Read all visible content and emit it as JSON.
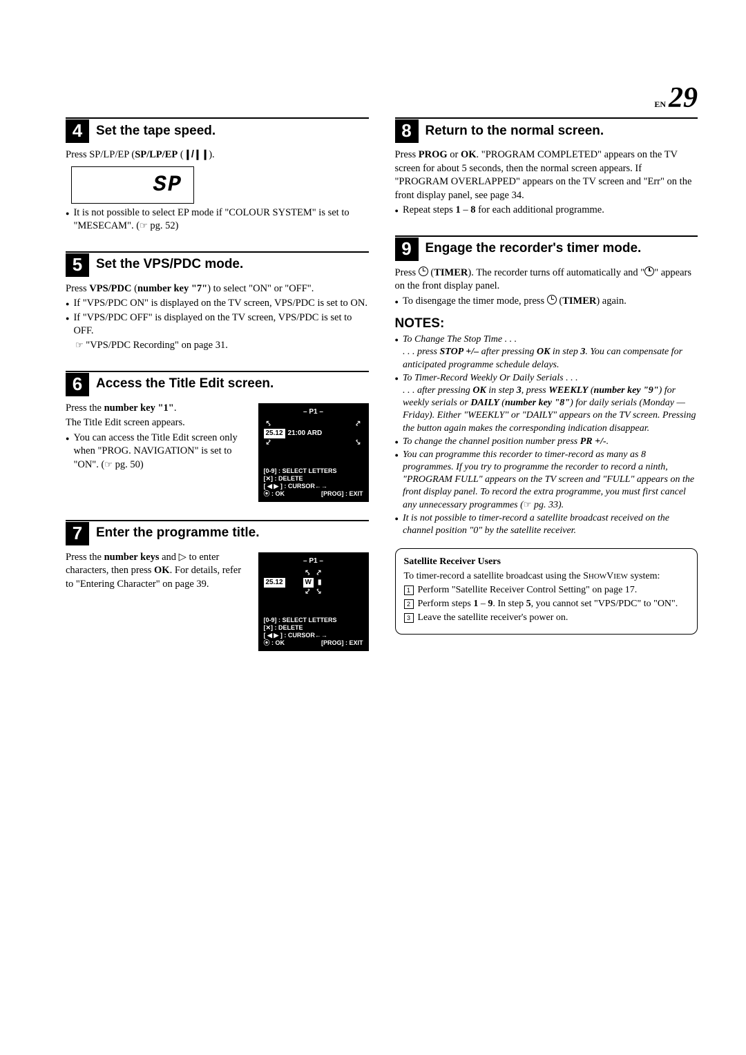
{
  "page": {
    "en": "EN",
    "num": "29"
  },
  "step4": {
    "num": "4",
    "title": "Set the tape speed.",
    "line": "Press SP/LP/EP (",
    "tapeglyph": "❙/❙❙",
    "line_end": ").",
    "sp": "SP",
    "bullet": "It is not possible to select EP mode if \"COLOUR SYSTEM\" is set to \"MESECAM\". (",
    "bullet_ref": "☞ pg. 52",
    "bullet_close": ")"
  },
  "step5": {
    "num": "5",
    "title": "Set the VPS/PDC mode.",
    "line": "Press VPS/PDC (number key \"7\") to select \"ON\" or \"OFF\".",
    "b1": "If \"VPS/PDC ON\" is displayed on the TV screen, VPS/PDC is set to ON.",
    "b2": "If \"VPS/PDC OFF\" is displayed on the TV screen, VPS/PDC is set to OFF.",
    "ref": "☞ \"VPS/PDC Recording\" on page 31."
  },
  "step6": {
    "num": "6",
    "title": "Access the Title Edit screen.",
    "l1": "Press the number key \"1\".",
    "l2": "The Title Edit screen appears.",
    "b": "You can access the Title Edit screen only when \"PROG. NAVIGATION\" is set to \"ON\". (",
    "b_ref": "☞ pg. 50",
    "b_close": ")",
    "screen": {
      "p1": "– P1 –",
      "date": "25.12",
      "time": "21:00 ARD",
      "leg1": "[0-9] : SELECT LETTERS",
      "leg2": "[✕] : DELETE",
      "leg3": "[ ◀ ▶ ] : CURSOR←→",
      "leg4a": "⦿ : OK",
      "leg4b": "[PROG] : EXIT"
    }
  },
  "step7": {
    "num": "7",
    "title": "Enter the programme title.",
    "l": "Press the number keys and ▷ to enter characters, then press OK. For details, refer to \"Entering Character\" on page 39.",
    "screen": {
      "p1": "– P1 –",
      "date": "25.12",
      "w": "W",
      "leg1": "[0-9] : SELECT LETTERS",
      "leg2": "[✕] : DELETE",
      "leg3": "[ ◀ ▶ ] : CURSOR←→",
      "leg4a": "⦿ : OK",
      "leg4b": "[PROG] : EXIT"
    }
  },
  "step8": {
    "num": "8",
    "title": "Return to the normal screen.",
    "p": "Press PROG or OK. \"PROGRAM COMPLETED\" appears on the TV screen for about 5 seconds, then the normal screen appears. If \"PROGRAM OVERLAPPED\" appears on the TV screen and \"Err\" on the front display panel, see page 34.",
    "b": "Repeat steps 1 – 8 for each additional programme."
  },
  "step9": {
    "num": "9",
    "title": "Engage the recorder's timer mode.",
    "p1a": "Press ",
    "p1b": " (TIMER). The recorder turns off automatically and \"",
    "p1c": "\" appears on the front display panel.",
    "b1a": "To disengage the timer mode, press ",
    "b1b": " (TIMER) again."
  },
  "notes": {
    "heading": "NOTES:",
    "n1": "To Change The Stop Time . . .",
    "n1b": ". . . press STOP +/– after pressing OK in step 3. You can compensate for anticipated programme schedule delays.",
    "n2": "To Timer-Record Weekly Or Daily Serials . . .",
    "n2b": ". . . after pressing OK in step 3, press WEEKLY (number key \"9\") for weekly serials or DAILY (number key \"8\") for daily serials (Monday — Friday). Either \"WEEKLY\" or \"DAILY\" appears on the TV screen. Pressing the button again makes the corresponding indication disappear.",
    "n3": "To change the channel position number press PR +/-.",
    "n4": "You can programme this recorder to timer-record as many as 8 programmes. If you try to programme the recorder to record a ninth, \"PROGRAM FULL\" appears on the TV screen and \"FULL\" appears on the front display panel. To record the extra programme, you must first cancel any unnecessary programmes (",
    "n4ref": "☞ pg. 33",
    "n4close": ").",
    "n5": "It is not possible to timer-record a satellite broadcast received on the channel position \"0\" by the satellite receiver."
  },
  "sat": {
    "title": "Satellite Receiver Users",
    "intro1": "To timer-record a satellite broadcast using the ",
    "sv": "ShowView",
    "intro2": " system:",
    "e1": "Perform \"Satellite Receiver Control Setting\" on page 17.",
    "e2": "Perform steps 1 – 9. In step 5, you cannot set \"VPS/PDC\" to \"ON\".",
    "e3": "Leave the satellite receiver's power on."
  }
}
